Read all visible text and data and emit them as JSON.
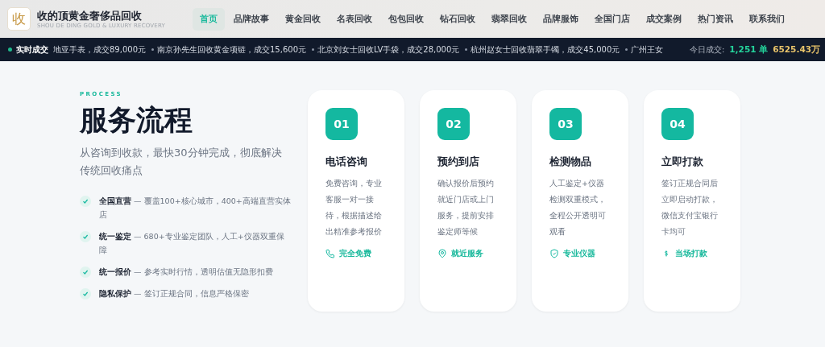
{
  "brand": {
    "logo_char": "收",
    "name": "收的顶黄金奢侈品回收",
    "tagline": "SHOU DE DING GOLD & LUXURY RECOVERY"
  },
  "nav": [
    {
      "label": "首页",
      "selected": true
    },
    {
      "label": "品牌故事",
      "selected": false
    },
    {
      "label": "黄金回收",
      "selected": false
    },
    {
      "label": "名表回收",
      "selected": false
    },
    {
      "label": "包包回收",
      "selected": false
    },
    {
      "label": "钻石回收",
      "selected": false
    },
    {
      "label": "翡翠回收",
      "selected": false
    },
    {
      "label": "品牌服饰",
      "selected": false
    },
    {
      "label": "全国门店",
      "selected": false
    },
    {
      "label": "成交案例",
      "selected": false
    },
    {
      "label": "热门资讯",
      "selected": false
    },
    {
      "label": "联系我们",
      "selected": false
    }
  ],
  "ticker": {
    "label": "实时成交",
    "items": [
      "地亚手表，成交89,000元",
      "南京孙先生回收黄金项链，成交15,600元",
      "北京刘女士回收LV手袋，成交28,000元",
      "杭州赵女士回收翡翠手镯，成交45,000元",
      "广州王女"
    ],
    "today_label": "今日成交:",
    "today_orders": "1,251 单",
    "today_amount": "6525.43万"
  },
  "process": {
    "eyebrow": "PROCESS",
    "title": "服务流程",
    "subtitle": "从咨询到收款，最快30分钟完成，彻底解决传统回收痛点",
    "features": [
      "**全国直营** — 覆盖100+核心城市，400+高端直营实体店",
      "**统一鉴定** — 680+专业鉴定团队，人工+仪器双重保障",
      "**统一报价** — 参考实时行情，透明估值无隐形扣费",
      "**隐私保护** — 签订正规合同，信息严格保密"
    ],
    "steps": [
      {
        "number": "01",
        "title": "电话咨询",
        "text": "免费咨询，专业客服一对一接待，根据描述给出精准参考报价",
        "tag": "完全免费",
        "kind": "phone"
      },
      {
        "number": "02",
        "title": "预约到店",
        "text": "确认报价后预约就近门店或上门服务，提前安排鉴定师等候",
        "tag": "就近服务",
        "kind": "location"
      },
      {
        "number": "03",
        "title": "检测物品",
        "text": "人工鉴定+仪器检测双重模式，全程公开透明可观看",
        "tag": "专业仪器",
        "kind": "shield"
      },
      {
        "number": "04",
        "title": "立即打款",
        "text": "签订正规合同后立即启动打款，微信支付宝银行卡均可",
        "tag": "当场打款",
        "kind": "money"
      }
    ]
  }
}
